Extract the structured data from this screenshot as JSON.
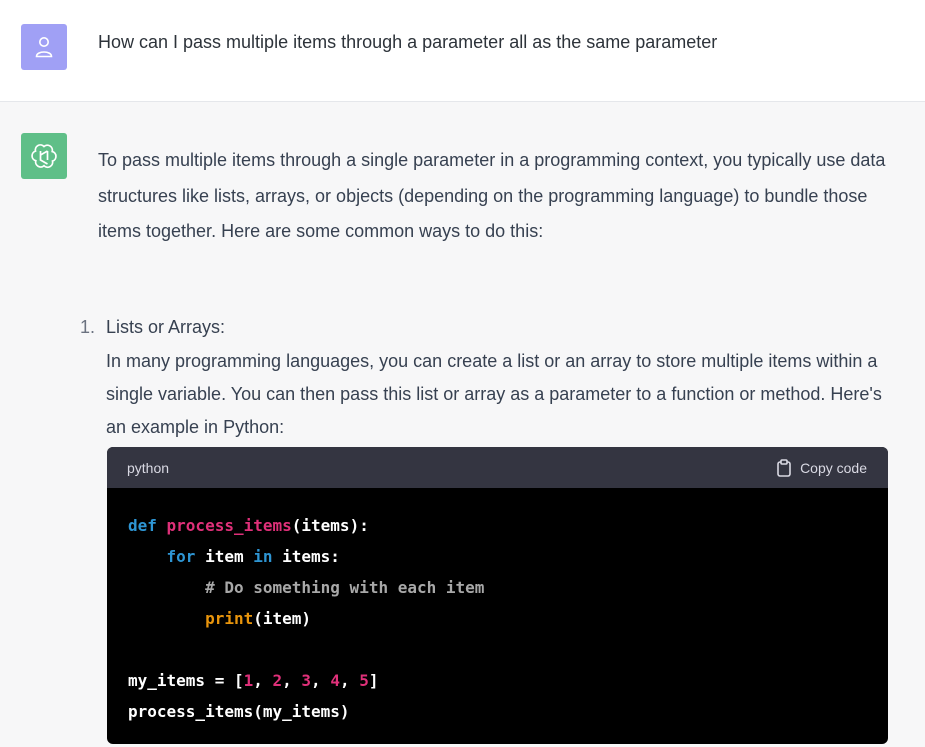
{
  "user_message": "How can I pass multiple items through a parameter all as the same parameter",
  "assistant": {
    "intro": "To pass multiple items through a single parameter in a programming context, you typically use data structures like lists, arrays, or objects (depending on the programming language) to bundle those items together. Here are some common ways to do this:",
    "list": [
      {
        "number": "1.",
        "title": "Lists or Arrays:",
        "body": "In many programming languages, you can create a list or an array to store multiple items within a single variable. You can then pass this list or array as a parameter to a function or method. Here's an example in Python:"
      }
    ],
    "code_block": {
      "language": "python",
      "copy_label": "Copy code",
      "lines": [
        [
          {
            "t": "def ",
            "c": "kw"
          },
          {
            "t": "process_items",
            "c": "fn"
          },
          {
            "t": "(items):",
            "c": ""
          }
        ],
        [
          {
            "t": "    ",
            "c": ""
          },
          {
            "t": "for",
            "c": "kw"
          },
          {
            "t": " item ",
            "c": ""
          },
          {
            "t": "in",
            "c": "kw"
          },
          {
            "t": " items:",
            "c": ""
          }
        ],
        [
          {
            "t": "        # Do something with each item",
            "c": "cm"
          }
        ],
        [
          {
            "t": "        ",
            "c": ""
          },
          {
            "t": "print",
            "c": "bi"
          },
          {
            "t": "(item)",
            "c": ""
          }
        ],
        [
          {
            "t": "",
            "c": ""
          }
        ],
        [
          {
            "t": "my_items = [",
            "c": ""
          },
          {
            "t": "1",
            "c": "num"
          },
          {
            "t": ", ",
            "c": ""
          },
          {
            "t": "2",
            "c": "num"
          },
          {
            "t": ", ",
            "c": ""
          },
          {
            "t": "3",
            "c": "num"
          },
          {
            "t": ", ",
            "c": ""
          },
          {
            "t": "4",
            "c": "num"
          },
          {
            "t": ", ",
            "c": ""
          },
          {
            "t": "5",
            "c": "num"
          },
          {
            "t": "]",
            "c": ""
          }
        ],
        [
          {
            "t": "process_items(my_items)",
            "c": ""
          }
        ]
      ]
    }
  },
  "colors": {
    "user_avatar_bg": "#a0a0f5",
    "assistant_avatar_bg": "#5fbf88",
    "assistant_row_bg": "#f7f7f8",
    "code_bg": "#000000",
    "code_header_bg": "#343541"
  },
  "icons": {
    "user_avatar": "person-icon",
    "assistant_avatar": "openai-logo-icon",
    "copy": "clipboard-icon"
  }
}
